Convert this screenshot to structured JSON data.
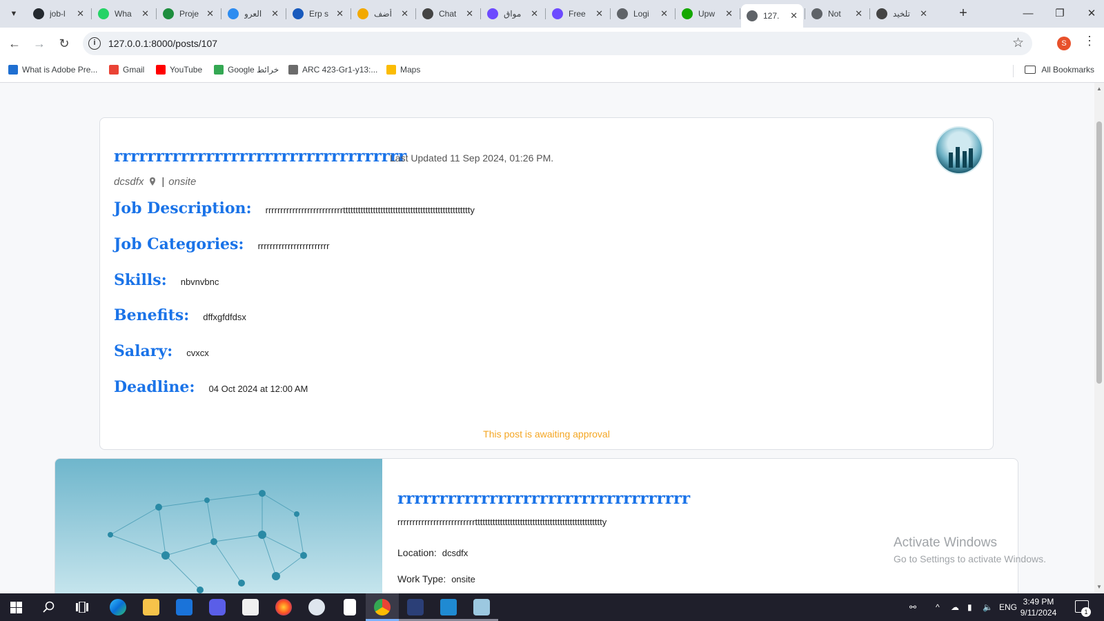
{
  "browser": {
    "tabs": [
      {
        "label": "job-l",
        "icon": "github-icon",
        "color": "#24292f"
      },
      {
        "label": "Wha",
        "icon": "whatsapp-icon",
        "color": "#25d366"
      },
      {
        "label": "Proje",
        "icon": "sheets-icon",
        "color": "#1e8e3e"
      },
      {
        "label": "العرو",
        "icon": "circle-icon",
        "color": "#2d8cf0"
      },
      {
        "label": "Erp s",
        "icon": "word-icon",
        "color": "#185abd"
      },
      {
        "label": "أضف",
        "icon": "number-five-icon",
        "color": "#f2a900"
      },
      {
        "label": "Chat",
        "icon": "openai-icon",
        "color": "#444444"
      },
      {
        "label": "مواق",
        "icon": "proton-icon",
        "color": "#6d4aff"
      },
      {
        "label": "Free",
        "icon": "proton-icon",
        "color": "#6d4aff"
      },
      {
        "label": "Logi",
        "icon": "clock-icon",
        "color": "#5f6368"
      },
      {
        "label": "Upw",
        "icon": "upwork-icon",
        "color": "#14a800"
      },
      {
        "label": "127.",
        "icon": "globe-icon",
        "color": "#5f6368",
        "active": true
      },
      {
        "label": "Not",
        "icon": "globe-icon",
        "color": "#5f6368"
      },
      {
        "label": "تلخيد",
        "icon": "openai-icon",
        "color": "#444444"
      }
    ],
    "url": "127.0.0.1:8000/posts/107",
    "profile_initial": "S",
    "bookmarks": [
      {
        "label": "What is Adobe Pre...",
        "color": "#1f6fd1"
      },
      {
        "label": "Gmail",
        "color": "#ea4335"
      },
      {
        "label": "YouTube",
        "color": "#ff0000"
      },
      {
        "label": "Google خرائط",
        "color": "#34a853"
      },
      {
        "label": "ARC 423-Gr1-y13:...",
        "color": "#6b6b6b"
      },
      {
        "label": "Maps",
        "color": "#fbbc04"
      }
    ],
    "all_bookmarks": "All Bookmarks"
  },
  "post": {
    "title": "rrrrrrrrrrrrrrrrrrrrrrrrrrrrrrrrrrr",
    "updated": "Last Updated 11 Sep 2024, 01:26 PM.",
    "location": "dcsdfx",
    "separator": "|",
    "work_type": "onsite",
    "fields": [
      {
        "label": "Job Description:",
        "value": "rrrrrrrrrrrrrrrrrrrrrrrrrrttttttttttttttttttttttttttttttttttttttttttttttttttty"
      },
      {
        "label": "Job Categories:",
        "value": "rrrrrrrrrrrrrrrrrrrrrrrr"
      },
      {
        "label": "Skills:",
        "value": "nbvnvbnc"
      },
      {
        "label": "Benefits:",
        "value": "dffxgfdfdsx"
      },
      {
        "label": "Salary:",
        "value": "cvxcx"
      },
      {
        "label": "Deadline:",
        "value": "04 Oct 2024 at 12:00 AM"
      }
    ],
    "status": "This post is awaiting approval"
  },
  "related": {
    "title": "rrrrrrrrrrrrrrrrrrrrrrrrrrrrrrrrrrr",
    "description": "rrrrrrrrrrrrrrrrrrrrrrrrrrttttttttttttttttttttttttttttttttttttttttttttttttttty",
    "location_label": "Location:",
    "location_value": "dcsdfx",
    "work_type_label": "Work Type:",
    "work_type_value": "onsite"
  },
  "watermark": {
    "line1": "Activate Windows",
    "line2": "Go to Settings to activate Windows."
  },
  "taskbar": {
    "language": "ENG",
    "time": "3:49 PM",
    "date": "9/11/2024",
    "notification_count": "1"
  }
}
